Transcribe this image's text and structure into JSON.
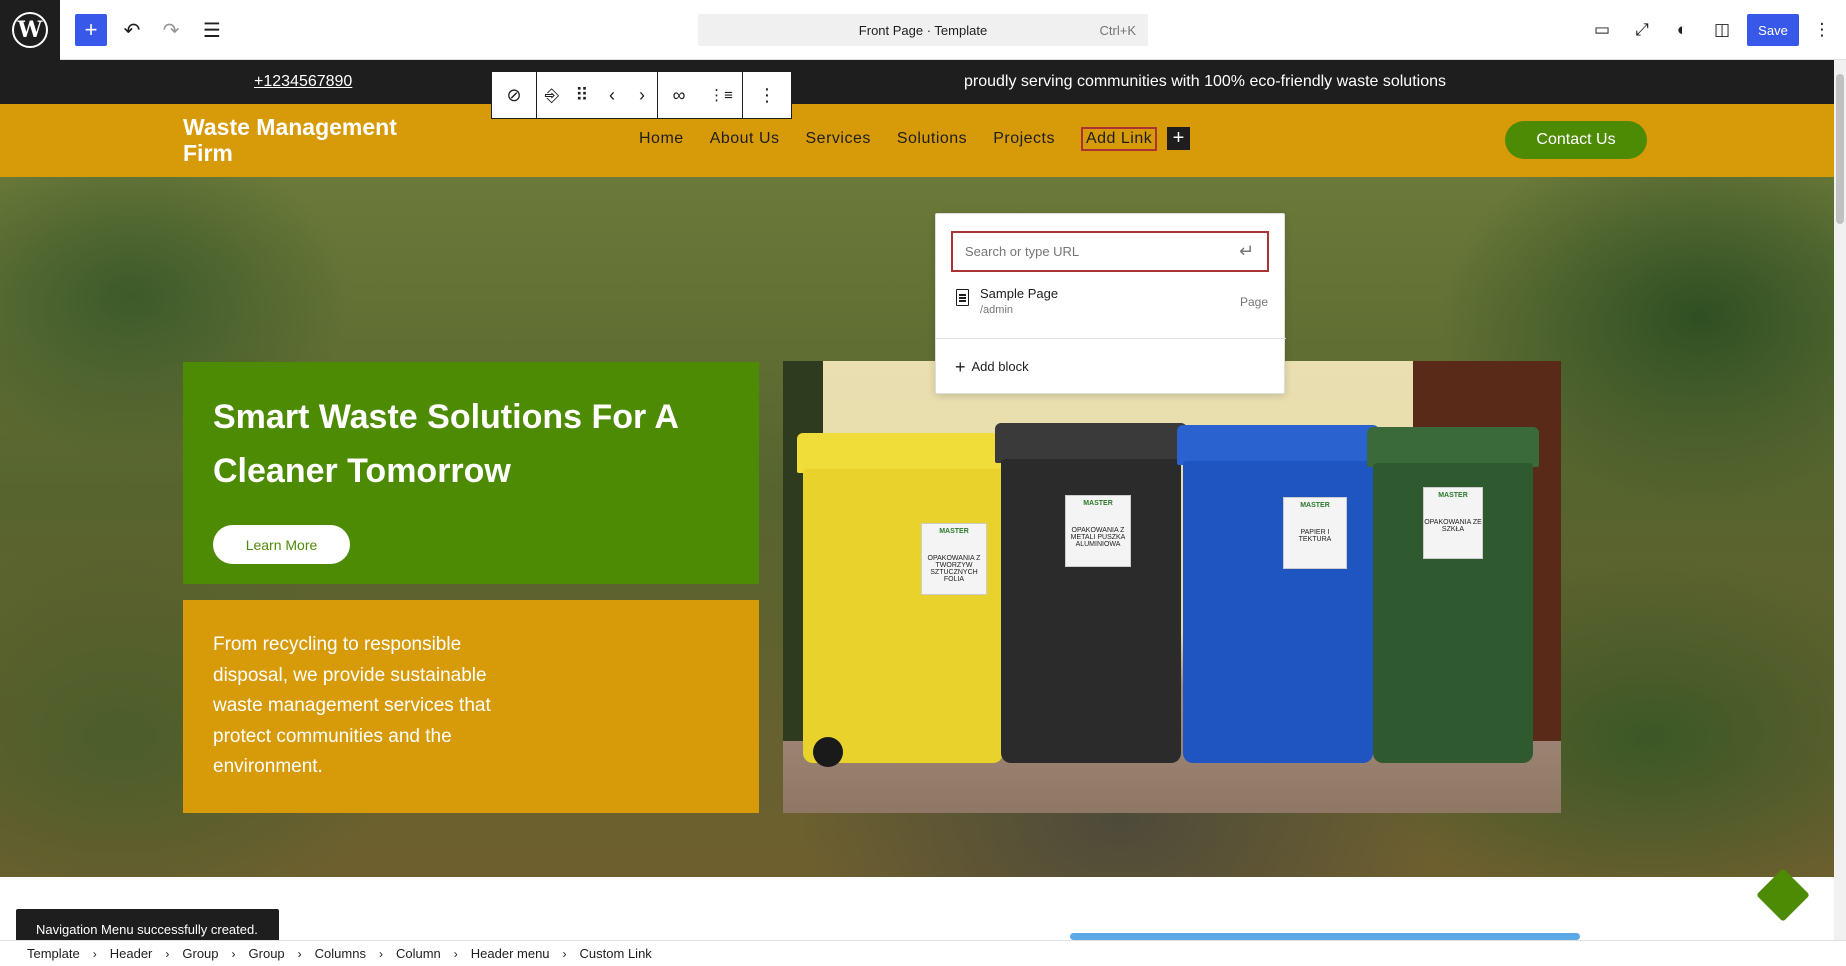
{
  "topbar": {
    "logo_letter": "W",
    "add_icon": "+",
    "undo_icon": "↶",
    "redo_icon": "↷",
    "list_icon": "☰",
    "command_title": "Front Page · Template",
    "command_shortcut": "Ctrl+K",
    "view_icon": "▭",
    "expand_icon": "⤢",
    "styles_icon": "◐",
    "sidebar_icon": "◫",
    "save_label": "Save",
    "options_icon": "⋮"
  },
  "announcement": {
    "phone": "+1234567890",
    "message": "proudly serving communities with 100% eco-friendly waste solutions"
  },
  "header": {
    "brand": "Waste Management Firm",
    "nav": [
      "Home",
      "About Us",
      "Services",
      "Solutions",
      "Projects",
      "Add Link"
    ],
    "nav_add_icon": "+",
    "contact_label": "Contact Us"
  },
  "block_toolbar": {
    "compass_icon": "⊘",
    "transform_icon": "⎆",
    "drag_icon": "⠿",
    "move_left_icon": "‹",
    "move_right_icon": "›",
    "link_icon": "∞",
    "submenu_icon": "⋮≡",
    "more_icon": "⋮"
  },
  "hero": {
    "heading": "Smart Waste Solutions For A Cleaner Tomorrow",
    "button_label": "Learn More",
    "description": "From recycling to responsible disposal, we provide sustainable waste management services that protect communities and the environment."
  },
  "photo": {
    "bin_labels": [
      "MASTER",
      "MASTER",
      "MASTER",
      "MASTER"
    ],
    "bin_captions": [
      "OPAKOWANIA Z TWORZYW SZTUCZNYCH FOLIA",
      "OPAKOWANIA Z METALI PUSZKA ALUMINIOWA",
      "PAPIER I TEKTURA",
      "OPAKOWANIA ZE SZKŁA"
    ],
    "colors": {
      "yellow": "#e8d22b",
      "black": "#2b2b2b",
      "blue": "#1f55c0",
      "green": "#2f5a2f"
    }
  },
  "link_popover": {
    "placeholder": "Search or type URL",
    "enter_icon": "↵",
    "suggestion_title": "Sample Page",
    "suggestion_url": "/admin",
    "suggestion_type": "Page",
    "add_block_label": "Add block",
    "add_block_icon": "+"
  },
  "snackbar": {
    "message": "Navigation Menu successfully created."
  },
  "breadcrumb": {
    "items": [
      "Template",
      "Header",
      "Group",
      "Group",
      "Columns",
      "Column",
      "Header menu",
      "Custom Link"
    ],
    "separator": "›"
  },
  "colors": {
    "accent": "#3858e9",
    "brand_gold": "#d79b0a",
    "brand_green": "#4e8b05",
    "selection_red": "#aa3333"
  }
}
